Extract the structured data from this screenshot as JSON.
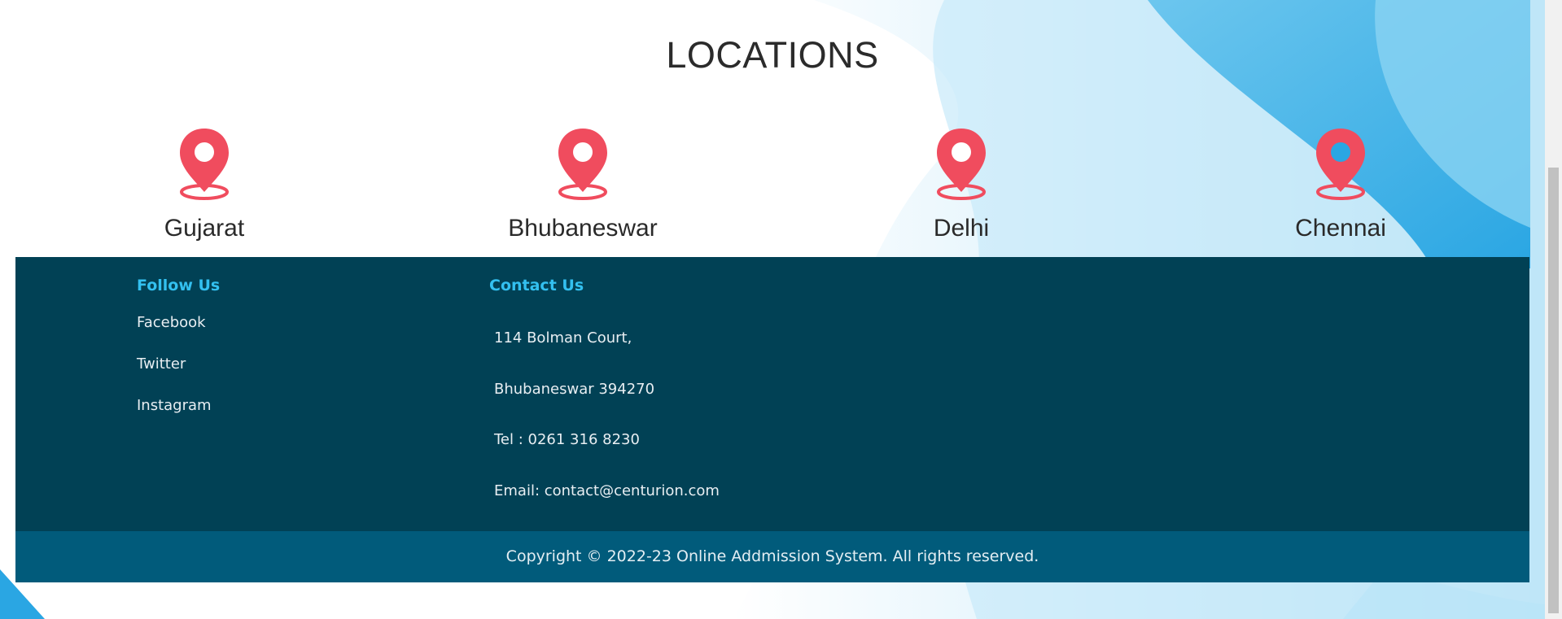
{
  "page": {
    "title": "LOCATIONS"
  },
  "locations": [
    {
      "name": "Gujarat",
      "icon": "map-pin-icon"
    },
    {
      "name": "Bhubaneswar",
      "icon": "map-pin-icon"
    },
    {
      "name": "Delhi",
      "icon": "map-pin-icon"
    },
    {
      "name": "Chennai",
      "icon": "map-pin-icon"
    }
  ],
  "footer": {
    "follow_heading": "Follow Us",
    "follow_links": [
      "Facebook",
      "Twitter",
      "Instagram"
    ],
    "contact_heading": "Contact Us",
    "contact_lines": [
      "114 Bolman Court,",
      "Bhubaneswar 394270",
      "Tel : 0261 316 8230",
      "Email: contact@centurion.com"
    ],
    "copyright": "Copyright © 2022-23 Online Addmission System. All rights reserved."
  },
  "colors": {
    "pin": "#f04c5e",
    "footer_bg": "#014155",
    "copyright_bg": "#015b7b",
    "heading_accent": "#33c0f0",
    "background_accent": "#2aa6e3"
  }
}
